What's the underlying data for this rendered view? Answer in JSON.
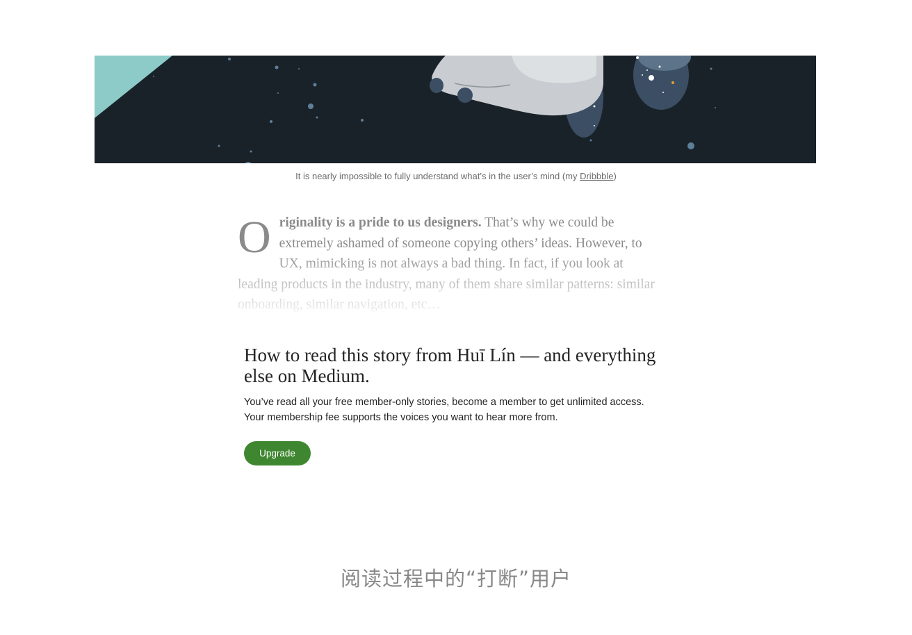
{
  "hero": {
    "caption_text": "It is nearly impossible to fully understand what’s in the user’s mind (my ",
    "caption_link": "Dribbble",
    "caption_end": ")"
  },
  "article": {
    "dropcap": "O",
    "lead_bold": "riginality is a pride to us designers.",
    "body": " That’s why we could be extremely ashamed of someone copying others’ ideas. However, to UX, mimicking is not always a bad thing. In fact, if you look at leading products in the industry, many of them share similar patterns: similar onboarding, similar navigation, etc…"
  },
  "paywall": {
    "title": "How to read this story from Huī Lín — and everything else on Medium.",
    "line1": "You’ve read all your free member-only stories, become a member to get unlimited access.",
    "line2": "Your membership fee supports the voices you want to hear more from.",
    "upgrade_label": "Upgrade",
    "accent": "#3e8730"
  },
  "footer": {
    "caption": "阅读过程中的“打断”用户"
  },
  "colors": {
    "hero_background": "#1a2229",
    "hero_accent": "#8ccbc8"
  }
}
